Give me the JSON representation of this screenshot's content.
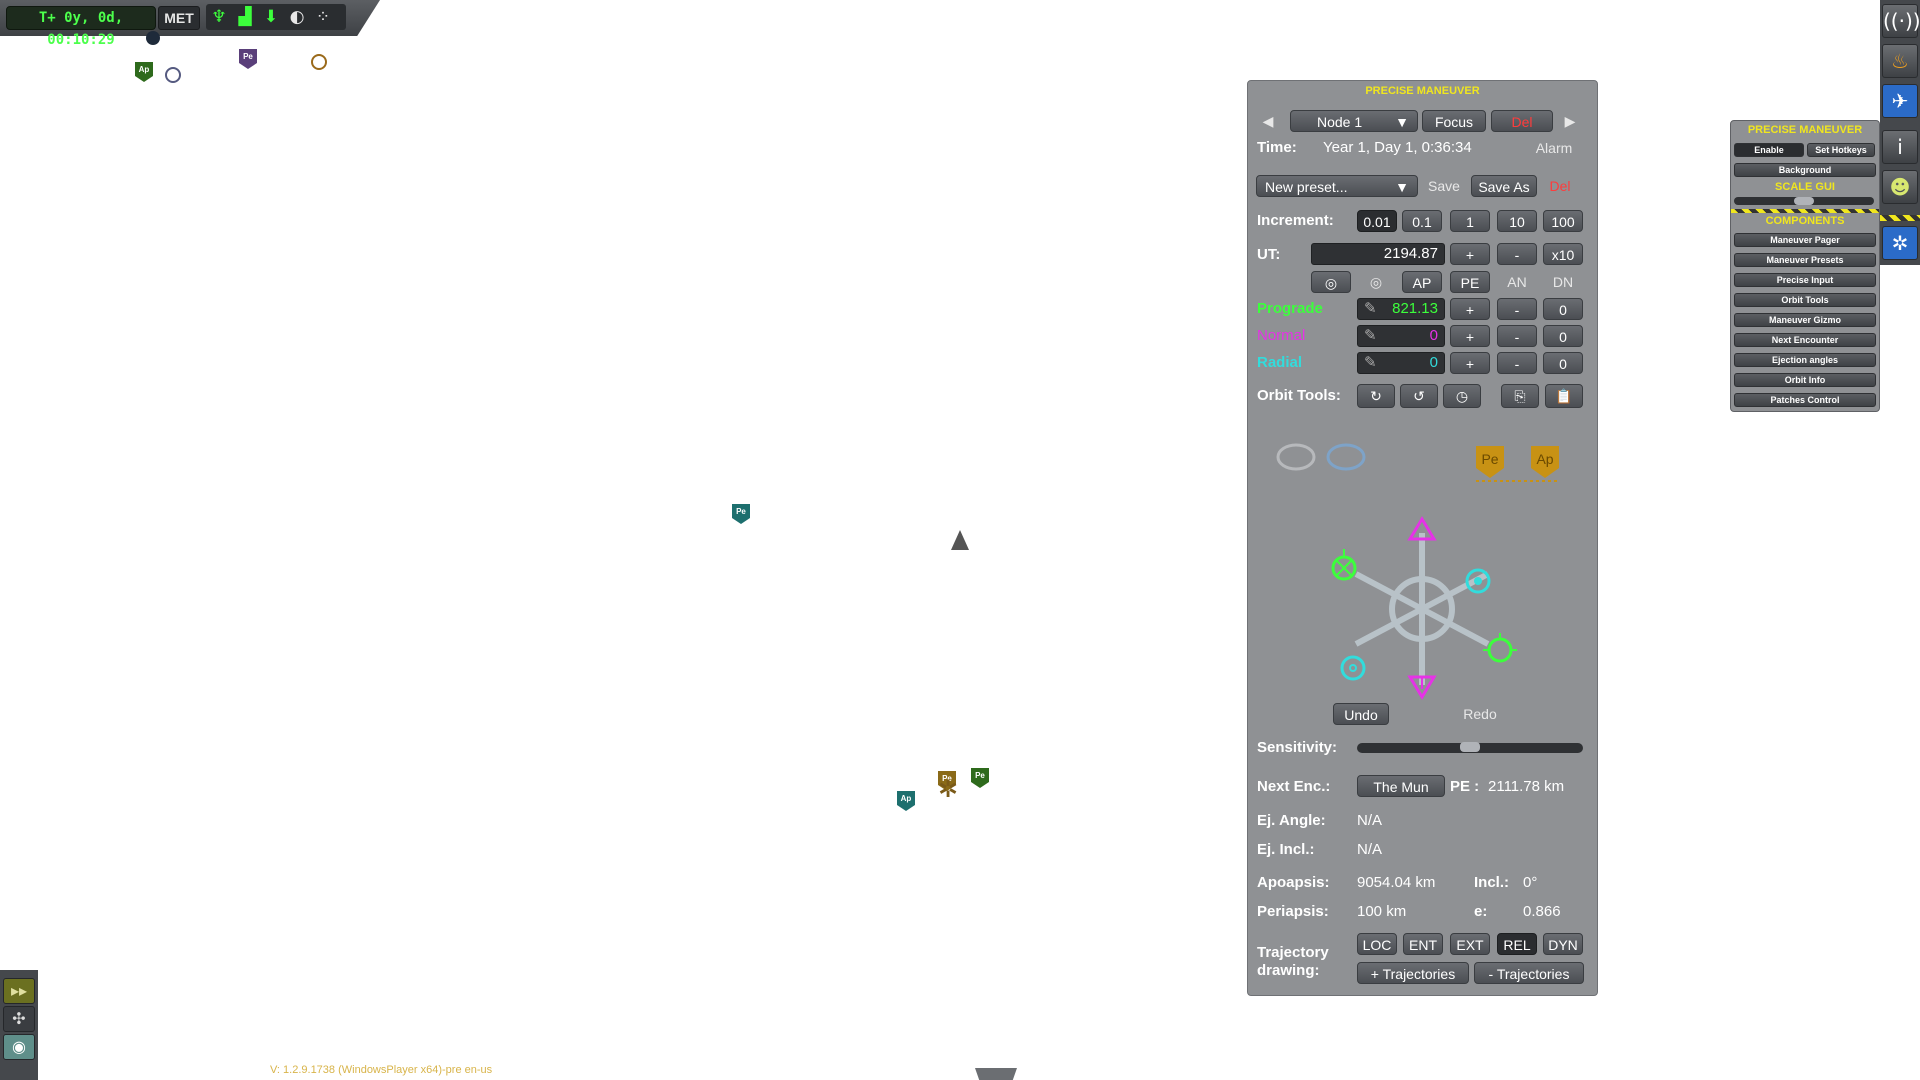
{
  "met": {
    "time": "T+ 0y, 0d, 00:10:29",
    "mode_label": "MET",
    "icons": [
      "antenna-icon",
      "signal-bars-icon",
      "download-arrow-icon",
      "globe-icon",
      "network-icon"
    ]
  },
  "map_markers": [
    {
      "label": "Ap",
      "color": "#2e6a1c"
    },
    {
      "label": "Pe",
      "color": "#5a3f7a"
    },
    {
      "label": "Pe",
      "color": "#1d6f6e"
    },
    {
      "label": "Ap",
      "color": "#1d6f6e"
    },
    {
      "label": "Pe",
      "color": "#8a6a18"
    },
    {
      "label": "Pe",
      "color": "#2e6a1c"
    }
  ],
  "pm": {
    "title": "PRECISE MANEUVER",
    "prev": "◀",
    "next": "▶",
    "node_select": "Node 1",
    "focus": "Focus",
    "del": "Del",
    "time_label": "Time:",
    "time_value": "Year 1, Day 1, 0:36:34",
    "alarm": "Alarm",
    "preset_select": "New preset...",
    "save": "Save",
    "save_as": "Save As",
    "preset_del": "Del",
    "increment_label": "Increment:",
    "increments": [
      "0.01",
      "0.1",
      "1",
      "10",
      "100"
    ],
    "increment_selected": "0.01",
    "ut_label": "UT:",
    "ut_value": "2194.87",
    "plus": "+",
    "minus": "-",
    "x10": "x10",
    "ap": "AP",
    "pe": "PE",
    "an": "AN",
    "dn": "DN",
    "prograde_label": "Prograde",
    "prograde_value": "821.13",
    "normal_label": "Normal",
    "normal_value": "0",
    "radial_label": "Radial",
    "radial_value": "0",
    "zero": "0",
    "orbit_tools_label": "Orbit Tools:",
    "gizmo_pe": "Pe",
    "gizmo_ap": "Ap",
    "undo": "Undo",
    "redo": "Redo",
    "sensitivity_label": "Sensitivity:",
    "sensitivity_level": 0.5,
    "next_enc_label": "Next Enc.:",
    "next_enc_value": "The Mun",
    "next_enc_pe_label": "PE :",
    "next_enc_pe_value": "2111.78 km",
    "ej_angle_label": "Ej. Angle:",
    "ej_angle_value": "N/A",
    "ej_incl_label": "Ej. Incl.:",
    "ej_incl_value": "N/A",
    "apoapsis_label": "Apoapsis:",
    "apoapsis_value": "9054.04 km",
    "incl_label": "Incl.:",
    "incl_value": "0°",
    "periapsis_label": "Periapsis:",
    "periapsis_value": "100 km",
    "e_label": "e:",
    "e_value": "0.866",
    "traj_label_1": "Trajectory",
    "traj_label_2": "drawing:",
    "traj_modes": [
      "LOC",
      "ENT",
      "EXT",
      "REL",
      "DYN"
    ],
    "traj_selected": "REL",
    "traj_plus": "+ Trajectories",
    "traj_minus": "- Trajectories"
  },
  "mini": {
    "title": "PRECISE MANEUVER",
    "enable": "Enable",
    "set_hotkeys": "Set Hotkeys",
    "background": "Background",
    "scale_gui": "SCALE GUI",
    "components": "COMPONENTS",
    "items": [
      "Maneuver Pager",
      "Maneuver Presets",
      "Precise Input",
      "Orbit Tools",
      "Maneuver Gizmo",
      "Next Encounter",
      "Ejection angles",
      "Orbit Info",
      "Patches Control"
    ]
  },
  "right_apps": [
    "comm-signal-icon",
    "fuel-icon",
    "precise-maneuver-icon",
    "info-icon",
    "kerbal-icon",
    "maneuver-gizmo-icon"
  ],
  "left_apps": [
    "flight-mode-icon",
    "science-icon",
    "map-view-icon"
  ],
  "version": "V: 1.2.9.1738 (WindowsPlayer x64)-pre en-us",
  "colors": {
    "prograde": "#3cff3c",
    "normal": "#e632e6",
    "radial": "#32dcdc",
    "title": "#f0e61e",
    "danger": "#ff3c3c"
  }
}
